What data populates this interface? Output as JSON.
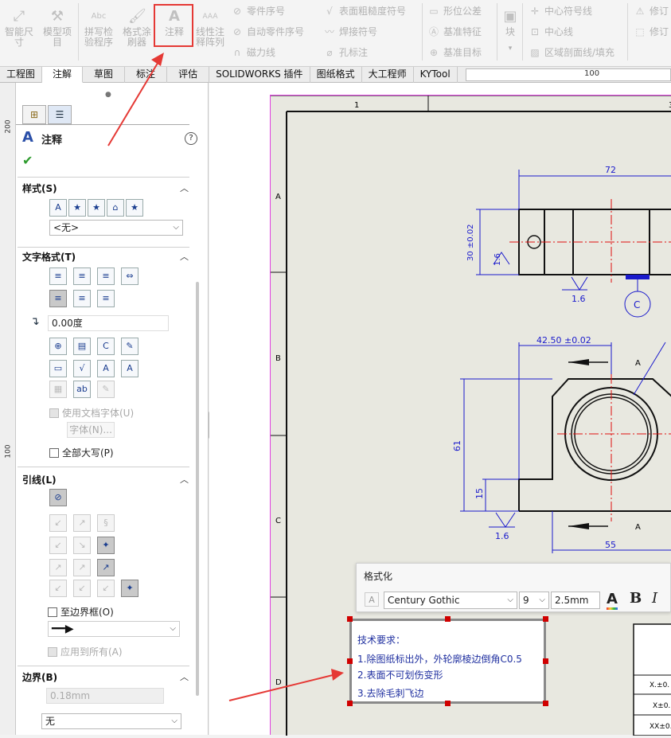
{
  "ribbon": {
    "big_buttons": [
      "智能尺\n寸",
      "模型项\n目",
      "拼写检\n验程序",
      "格式涂\n刷器",
      "注释",
      "线性注\n释阵列"
    ],
    "col1": [
      "零件序号",
      "自动零件序号",
      "磁力线"
    ],
    "col2": [
      "表面粗糙度符号",
      "焊接符号",
      "孔标注"
    ],
    "col3": [
      "形位公差",
      "基准特征",
      "基准目标"
    ],
    "block": "块",
    "col4": [
      "中心符号线",
      "中心线",
      "区域剖面线/填充"
    ],
    "col5": [
      "修订",
      "修订"
    ]
  },
  "tabs": [
    "工程图",
    "注解",
    "草图",
    "标注",
    "评估",
    "SOLIDWORKS 插件",
    "图纸格式",
    "大工程师",
    "KYTool"
  ],
  "active_tab": "注解",
  "ruler": {
    "top": "100",
    "left_200": "200",
    "left_100": "100"
  },
  "pm": {
    "title": "注释",
    "help": "?",
    "ok": "✔",
    "style_section": "样式(S)",
    "style_value": "<无>",
    "text_format_section": "文字格式(T)",
    "angle_value": "0.00度",
    "use_doc_font": "使用文档字体(U)",
    "font_button": "字体(N)...",
    "all_caps": "全部大写(P)",
    "leader_section": "引线(L)",
    "to_border": "至边界框(O)",
    "apply_all": "应用到所有(A)",
    "border_section": "边界(B)",
    "border_thickness": "0.18mm",
    "border_style": "无"
  },
  "drawing": {
    "zone_cols": [
      "1",
      "2",
      "3"
    ],
    "zone_rows": [
      "A",
      "B",
      "C",
      "D"
    ],
    "dims": {
      "d72": "72",
      "d30": "30 ±0.02",
      "r16a": "1.6",
      "r16b": "1.6",
      "datum_c": "C",
      "d42": "42.50 ±0.02",
      "d61": "61",
      "d15": "15",
      "r16c": "1.6",
      "d55": "55",
      "sec_a1": "A",
      "sec_a2": "A"
    },
    "title_block": [
      "X.±0.",
      "X±0.",
      "XX±0."
    ]
  },
  "format_toolbar": {
    "title": "格式化",
    "font": "Century Gothic",
    "size": "9",
    "height": "2.5mm",
    "color_btn": "A",
    "bold": "B",
    "italic": "I"
  },
  "note": {
    "lines": [
      "技术要求：",
      "1.除图纸标出外，外轮廓棱边倒角C0.5",
      "2.表面不可划伤变形",
      "3.去除毛刺飞边"
    ]
  },
  "colors": {
    "dim": "#1a1acc",
    "red_box": "#e53935",
    "centerline": "#e01010"
  }
}
